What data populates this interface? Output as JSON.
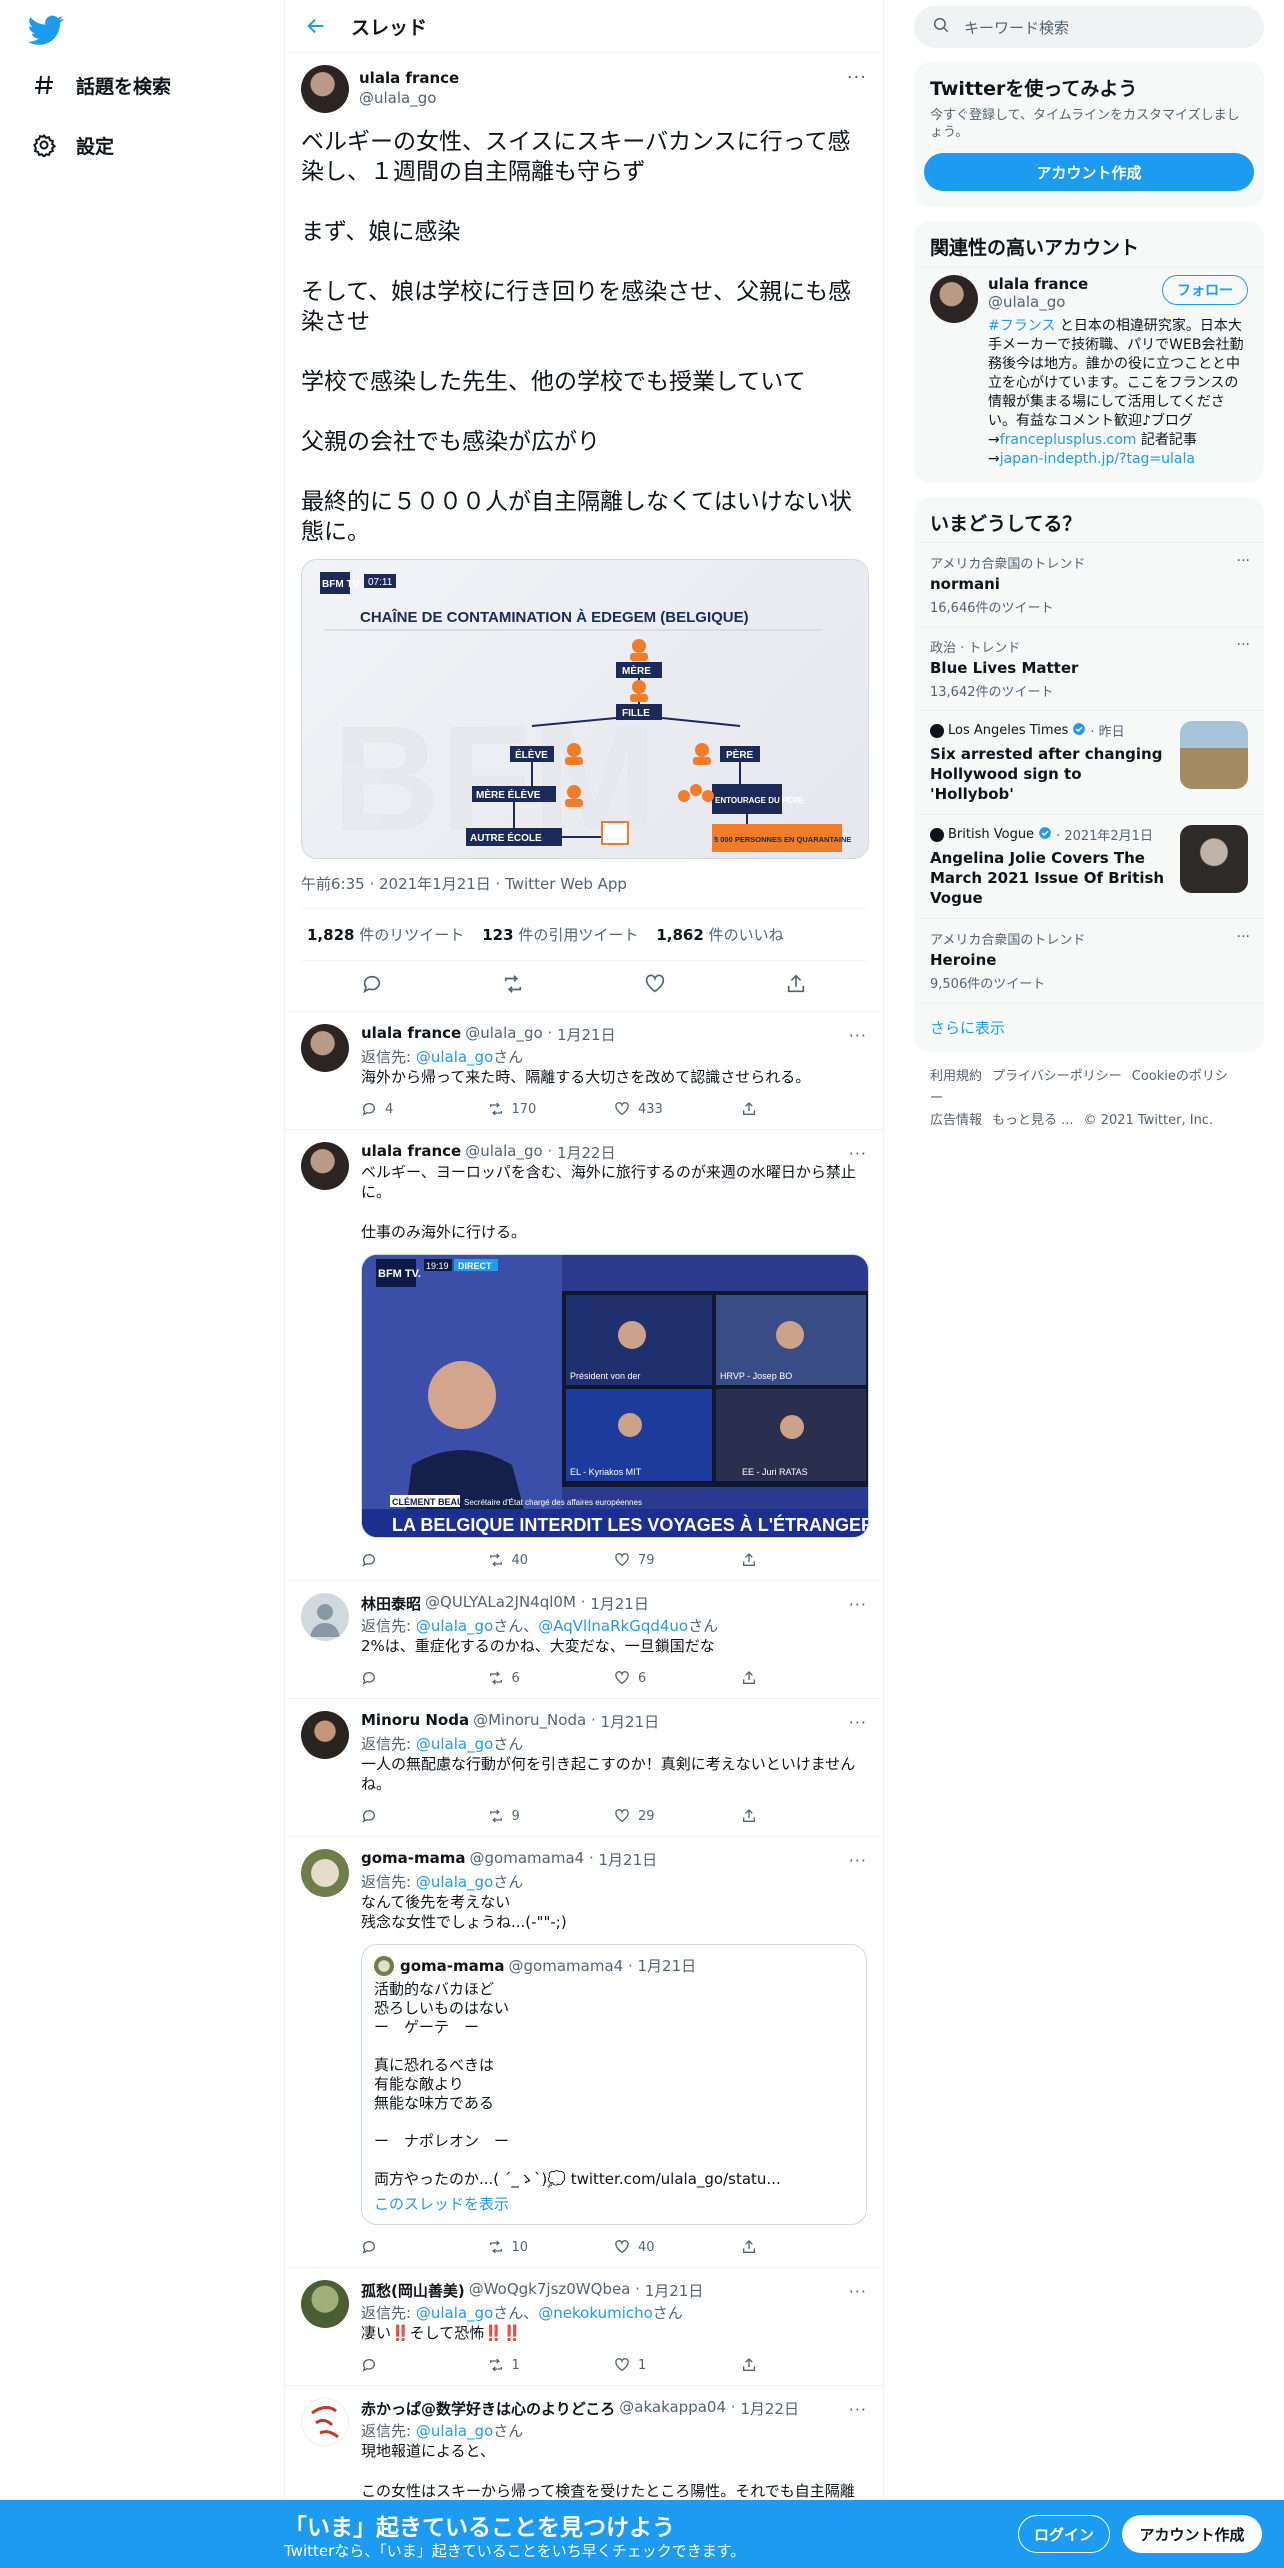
{
  "nav": {
    "items": [
      {
        "label": "話題を検索",
        "icon": "hashtag-icon"
      },
      {
        "label": "設定",
        "icon": "gear-icon"
      }
    ]
  },
  "header": {
    "title": "スレッド"
  },
  "focal": {
    "name": "ulala france",
    "handle": "@ulala_go",
    "paragraphs": [
      "ベルギーの女性、スイスにスキーバカンスに行って感染し、１週間の自主隔離も守らず",
      "まず、娘に感染",
      "そして、娘は学校に行き回りを感染させ、父親にも感染させ",
      "学校で感染した先生、他の学校でも授業していて",
      "父親の会社でも感染が広がり",
      "最終的に５０００人が自主隔離しなくてはいけない状態に。"
    ],
    "media": {
      "badge": "BFM TV.",
      "time": "07:11",
      "title": "CHAÎNE DE CONTAMINATION À EDEGEM (BELGIQUE)",
      "nodes": {
        "mere": "MÈRE",
        "fille": "FILLE",
        "eleve": "ÉLÈVE",
        "pere": "PÈRE",
        "mere_eleve": "MÈRE ÉLÈVE",
        "entourage": "ENTOURAGE DU PÈRE",
        "autre_ecole": "AUTRE ÉCOLE",
        "quarantaine": "5 000 PERSONNES EN QUARANTAINE"
      }
    },
    "timestamp": "午前6:35 · 2021年1月21日 · Twitter Web App",
    "stats": {
      "retweets": "1,828",
      "retweets_label": "件のリツイート",
      "quotes": "123",
      "quotes_label": "件の引用ツイート",
      "likes": "1,862",
      "likes_label": "件のいいね"
    }
  },
  "replies": [
    {
      "name": "ulala france",
      "handle": "@ulala_go",
      "date": "1月21日",
      "to_prefix": "返信先: ",
      "to": "@ulala_go",
      "to_suffix": "さん",
      "text": "海外から帰って来た時、隔離する大切さを改めて認識させられる。",
      "reply": "4",
      "rt": "170",
      "like": "433"
    },
    {
      "name": "ulala france",
      "handle": "@ulala_go",
      "date": "1月22日",
      "text": "ベルギー、ヨーロッパを含む、海外に旅行するのが来週の水曜日から禁止に。\n\n仕事のみ海外に行ける。",
      "media": {
        "badge": "BFM TV.",
        "time": "19:19",
        "live": "DIRECT",
        "person": "CLÉMENT BEAUNE",
        "role": "Secrétaire d'État chargé des affaires européennes",
        "headline": "LA BELGIQUE INTERDIT LES VOYAGES À L'ÉTRANGER",
        "tiles": [
          "Président von der",
          "HRVP - Josep BO",
          "EL - Kyriakos MIT",
          "EE - Juri RATAS"
        ]
      },
      "reply": "",
      "rt": "40",
      "like": "79"
    },
    {
      "name": "林田泰昭",
      "handle": "@QULYALa2JN4ql0M",
      "date": "1月21日",
      "to_prefix": "返信先: ",
      "to": "@ulala_go",
      "to_suffix": "さん、",
      "to2": "@AqVllnaRkGqd4uo",
      "to2_suffix": "さん",
      "text": "2%は、重症化するのかね、大変だな、一旦鎖国だな",
      "reply": "",
      "rt": "6",
      "like": "6"
    },
    {
      "name": "Minoru Noda",
      "handle": "@Minoru_Noda",
      "date": "1月21日",
      "to_prefix": "返信先: ",
      "to": "@ulala_go",
      "to_suffix": "さん",
      "text": "一人の無配慮な行動が何を引き起こすのか！真剣に考えないといけませんね。",
      "reply": "",
      "rt": "9",
      "like": "29"
    },
    {
      "name": "goma-mama",
      "handle": "@gomamama4",
      "date": "1月21日",
      "to_prefix": "返信先: ",
      "to": "@ulala_go",
      "to_suffix": "さん",
      "text": "なんて後先を考えない\n残念な女性でしょうね...(-\"\"-;)",
      "quote": {
        "name": "goma-mama",
        "handle": "@gomamama4",
        "date": "1月21日",
        "text": "活動的なバカほど\n恐ろしいものはない\nー　ゲーテ　ー\n\n真に恐れるべきは\n有能な敵より\n無能な味方である\n\nー　ナポレオン　ー\n\n両方やったのか...( ´_ゝ`)💭 twitter.com/ulala_go/statu...",
        "thread_link": "このスレッドを表示"
      },
      "reply": "",
      "rt": "10",
      "like": "40"
    },
    {
      "name": "孤愁(岡山善美)",
      "handle": "@WoQgk7jsz0WQbea",
      "date": "1月21日",
      "to_prefix": "返信先: ",
      "to": "@ulala_go",
      "to_suffix": "さん、",
      "to2": "@nekokumicho",
      "to2_suffix": "さん",
      "text": "凄い‼️そして恐怖‼️‼️",
      "reply": "",
      "rt": "1",
      "like": "1"
    },
    {
      "name": "赤かっぱ@数学好きは心のよりどころ",
      "handle": "@akakappa04",
      "date": "1月22日",
      "to_prefix": "返信先: ",
      "to": "@ulala_go",
      "to_suffix": "さん",
      "text": "現地報道によると、\n\nこの女性はスキーから帰って検査を受けたところ陽性。それでも自主隔離の義務があったらしいが、どの程度実行していたかは不明。離婚した人は自主隔離期間中も子供に会う権利があるので面会。その後の検査で陽性判"
    }
  ],
  "right": {
    "search_placeholder": "キーワード検索",
    "signup": {
      "title": "Twitterを使ってみよう",
      "sub": "今すぐ登録して、タイムラインをカスタマイズしましょう。",
      "button": "アカウント作成"
    },
    "relevant": {
      "title": "関連性の高いアカウント",
      "name": "ulala france",
      "handle": "@ulala_go",
      "follow": "フォロー",
      "bio_tag": "#フランス",
      "bio_1": " と日本の相違研究家。日本大手メーカーで技術職、パリでWEB会社勤務後今は地方。誰かの役に立つことと中立を心がけています。ここをフランスの情報が集まる場にして活用してください。有益なコメント歓迎♪ブログ→",
      "bio_link1": "franceplusplus.com",
      "bio_2": " 記者記事→",
      "bio_link2": "japan-indepth.jp/?tag=ulala"
    },
    "trends": {
      "title": "いまどうしてる？",
      "items": [
        {
          "kind": "trend",
          "ctx": "アメリカ合衆国のトレンド",
          "title": "normani",
          "count": "16,646件のツイート"
        },
        {
          "kind": "trend",
          "ctx": "政治 · トレンド",
          "title": "Blue Lives Matter",
          "count": "13,642件のツイート"
        },
        {
          "kind": "news",
          "src": "Los Angeles Times",
          "when": "· 昨日",
          "title": "Six arrested after changing Hollywood sign to 'Hollybob'"
        },
        {
          "kind": "news",
          "src": "British Vogue",
          "when": "· 2021年2月1日",
          "title": "Angelina Jolie Covers The March 2021 Issue Of British Vogue"
        },
        {
          "kind": "trend",
          "ctx": "アメリカ合衆国のトレンド",
          "title": "Heroine",
          "count": "9,506件のツイート"
        }
      ],
      "more": "さらに表示"
    },
    "footer": [
      "利用規約",
      "プライバシーポリシー",
      "Cookieのポリシー",
      "広告情報",
      "もっと見る ...",
      "© 2021 Twitter, Inc."
    ]
  },
  "bottombar": {
    "title": "「いま」起きていることを見つけよう",
    "sub": "Twitterなら、「いま」起きていることをいち早くチェックできます。",
    "login": "ログイン",
    "signup": "アカウント作成"
  },
  "colors": {
    "accent": "#1d9bf0",
    "text": "#0f1419",
    "muted": "#536471",
    "border": "#eff3f4"
  }
}
